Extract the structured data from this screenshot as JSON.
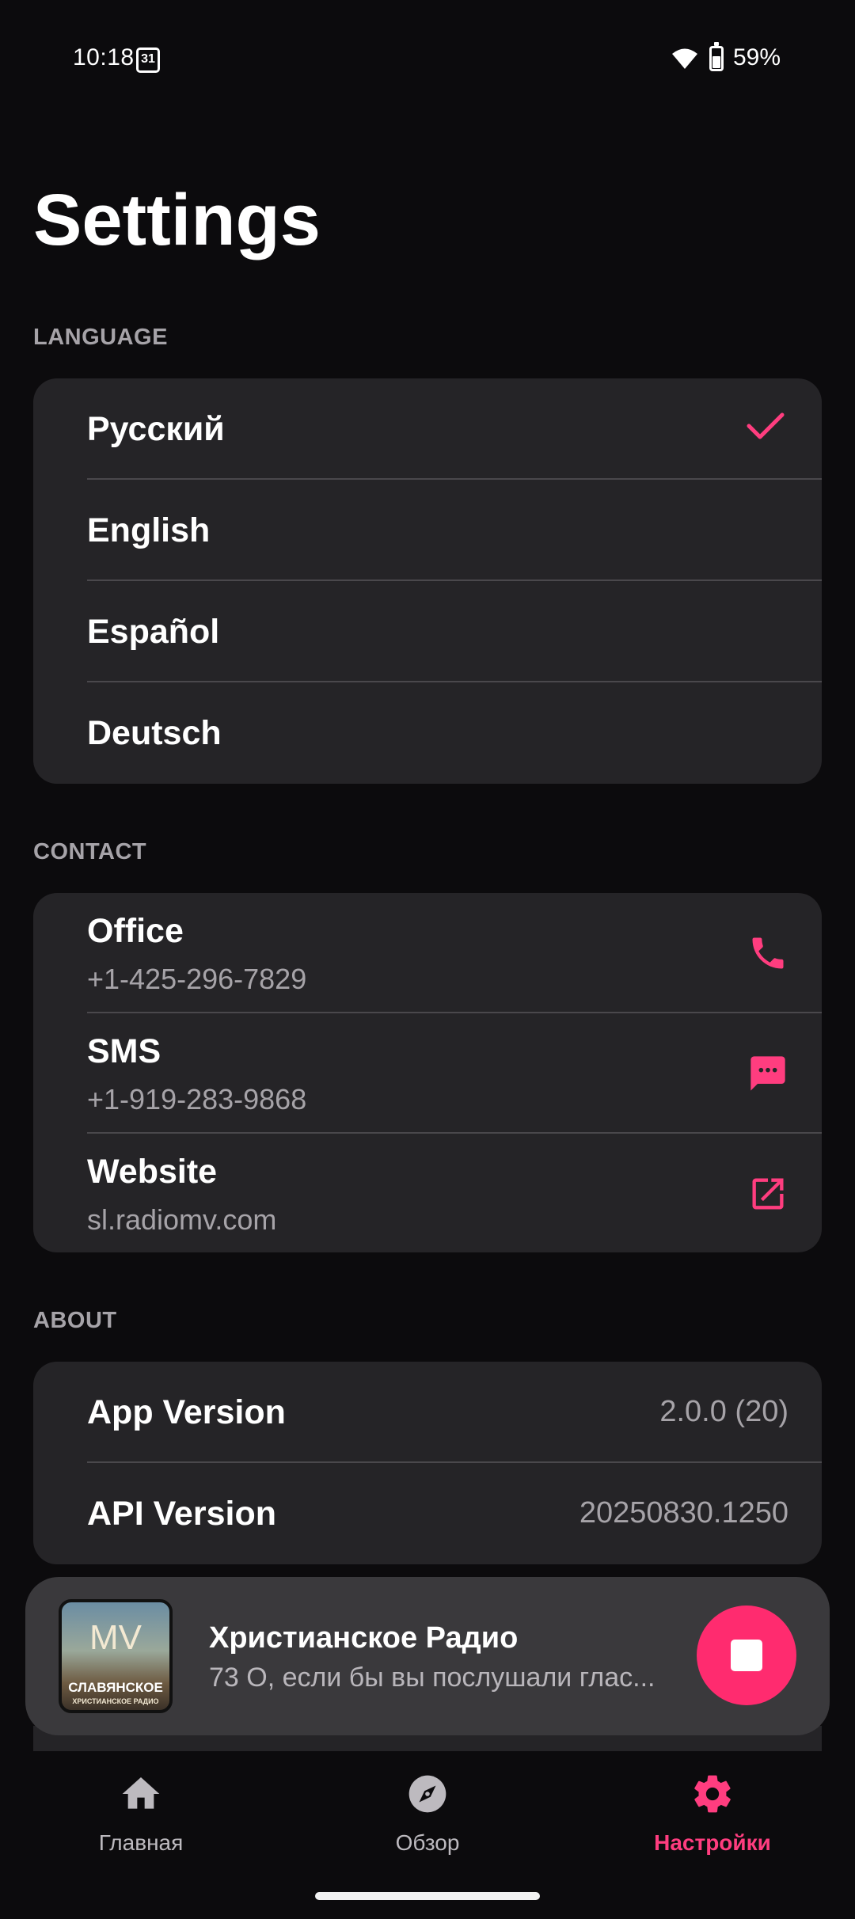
{
  "status_bar": {
    "time": "10:18",
    "calendar_day": "31",
    "battery_percent": "59%",
    "battery_level": 0.59
  },
  "page": {
    "title": "Settings"
  },
  "language": {
    "section_label": "LANGUAGE",
    "items": [
      {
        "label": "Русский",
        "selected": true
      },
      {
        "label": "English",
        "selected": false
      },
      {
        "label": "Español",
        "selected": false
      },
      {
        "label": "Deutsch",
        "selected": false
      }
    ]
  },
  "contact": {
    "section_label": "CONTACT",
    "items": [
      {
        "title": "Office",
        "value": "+1-425-296-7829",
        "icon": "phone-icon"
      },
      {
        "title": "SMS",
        "value": "+1-919-283-9868",
        "icon": "message-icon"
      },
      {
        "title": "Website",
        "value": "sl.radiomv.com",
        "icon": "open-external-icon"
      }
    ]
  },
  "about": {
    "section_label": "ABOUT",
    "items": [
      {
        "title": "App Version",
        "value": "2.0.0 (20)"
      },
      {
        "title": "API Version",
        "value": "20250830.1250"
      }
    ]
  },
  "player": {
    "title": "Христианское Радио",
    "subtitle": "73 О, если бы вы послушали глас...",
    "art_line1": "СЛАВЯНСКОЕ",
    "art_line2": "ХРИСТИАНСКОЕ РАДИО",
    "art_logo": "MV"
  },
  "nav": {
    "items": [
      {
        "label": "Главная",
        "icon": "home-icon",
        "active": false
      },
      {
        "label": "Обзор",
        "icon": "compass-icon",
        "active": false
      },
      {
        "label": "Настройки",
        "icon": "gear-icon",
        "active": true
      }
    ]
  },
  "colors": {
    "accent": "#ff3d7f",
    "background": "#0c0b0d",
    "card": "#252427",
    "secondary_text": "#a6a3a8",
    "stop_button": "#ff2b6f"
  }
}
